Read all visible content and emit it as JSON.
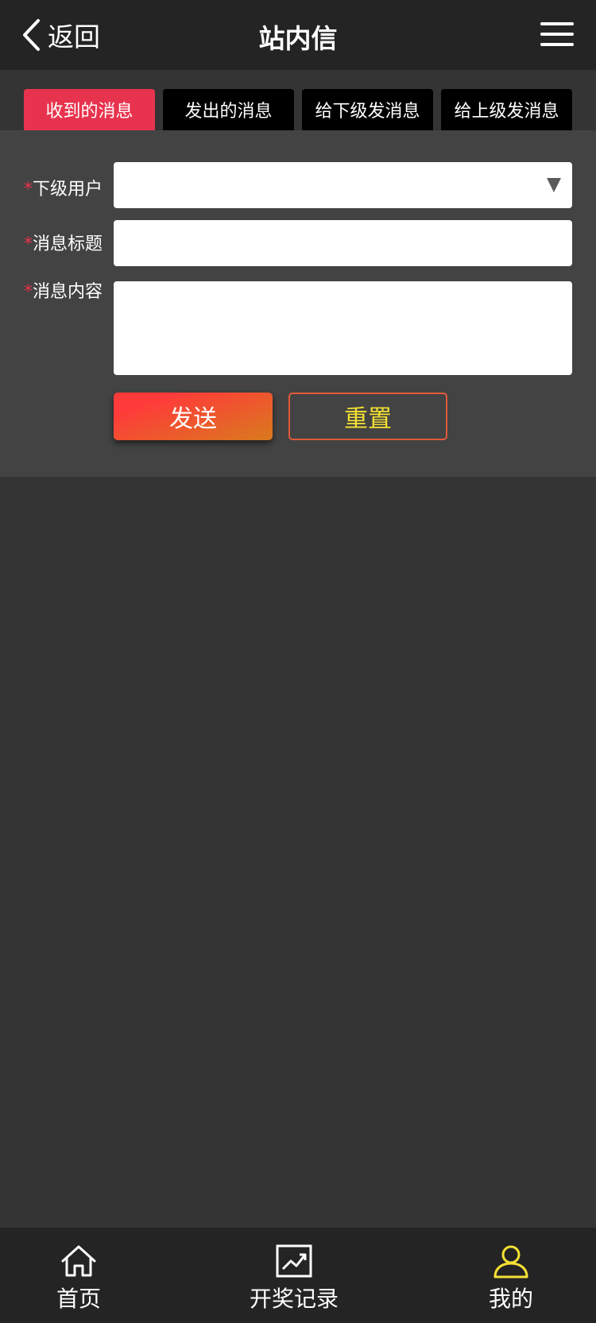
{
  "header": {
    "back_label": "返回",
    "title": "站内信",
    "back_icon": "chevron-left-icon",
    "menu_icon": "hamburger-menu-icon"
  },
  "tabs": [
    {
      "label": "收到的消息",
      "active": true
    },
    {
      "label": "发出的消息",
      "active": false
    },
    {
      "label": "给下级发消息",
      "active": false
    },
    {
      "label": "给上级发消息",
      "active": false
    }
  ],
  "form": {
    "required_mark": "*",
    "user_label": "下级用户",
    "user_value": "",
    "title_label": "消息标题",
    "title_value": "",
    "content_label": "消息内容",
    "content_value": "",
    "send_label": "发送",
    "reset_label": "重置"
  },
  "bottom_nav": [
    {
      "label": "首页",
      "icon": "home-icon",
      "active": false
    },
    {
      "label": "开奖记录",
      "icon": "chart-trend-icon",
      "active": false
    },
    {
      "label": "我的",
      "icon": "user-icon",
      "active": true
    }
  ],
  "colors": {
    "accent": "#e8334e",
    "active_nav": "#f5e233",
    "background": "#343434",
    "header": "#242424"
  }
}
